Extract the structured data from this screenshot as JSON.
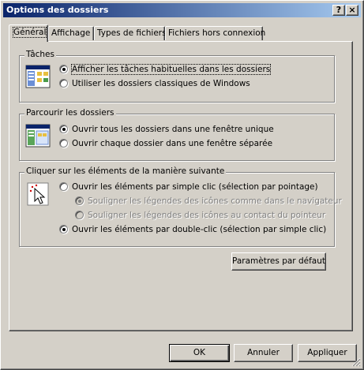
{
  "window": {
    "title": "Options des dossiers",
    "help_glyph": "?",
    "close_glyph": "×"
  },
  "tabs": [
    {
      "label": "Général"
    },
    {
      "label": "Affichage"
    },
    {
      "label": "Types de fichiers"
    },
    {
      "label": "Fichiers hors connexion"
    }
  ],
  "groups": {
    "taches": {
      "title": "Tâches",
      "options": [
        {
          "label": "Afficher les tâches habituelles dans les dossiers",
          "checked": true
        },
        {
          "label": "Utiliser les dossiers classiques de Windows",
          "checked": false
        }
      ]
    },
    "parcourir": {
      "title": "Parcourir les dossiers",
      "options": [
        {
          "label": "Ouvrir tous les dossiers dans une fenêtre unique",
          "checked": true
        },
        {
          "label": "Ouvrir chaque dossier dans une fenêtre séparée",
          "checked": false
        }
      ]
    },
    "cliquer": {
      "title": "Cliquer sur les éléments de la manière suivante",
      "options": [
        {
          "label": "Ouvrir les éléments par simple clic (sélection par pointage)",
          "checked": false
        },
        {
          "label": "Souligner les légendes des icônes comme dans le navigateur",
          "checked": true,
          "disabled": true
        },
        {
          "label": "Souligner les légendes des icônes au contact du pointeur",
          "checked": false,
          "disabled": true
        },
        {
          "label": "Ouvrir les éléments par double-clic (sélection par simple clic)",
          "checked": true
        }
      ]
    }
  },
  "buttons": {
    "defaults": "Paramètres par défaut",
    "ok": "OK",
    "cancel": "Annuler",
    "apply": "Appliquer"
  },
  "colors": {
    "titlebar_start": "#0a246a",
    "titlebar_end": "#a6caf0",
    "face": "#d4d0c8"
  }
}
